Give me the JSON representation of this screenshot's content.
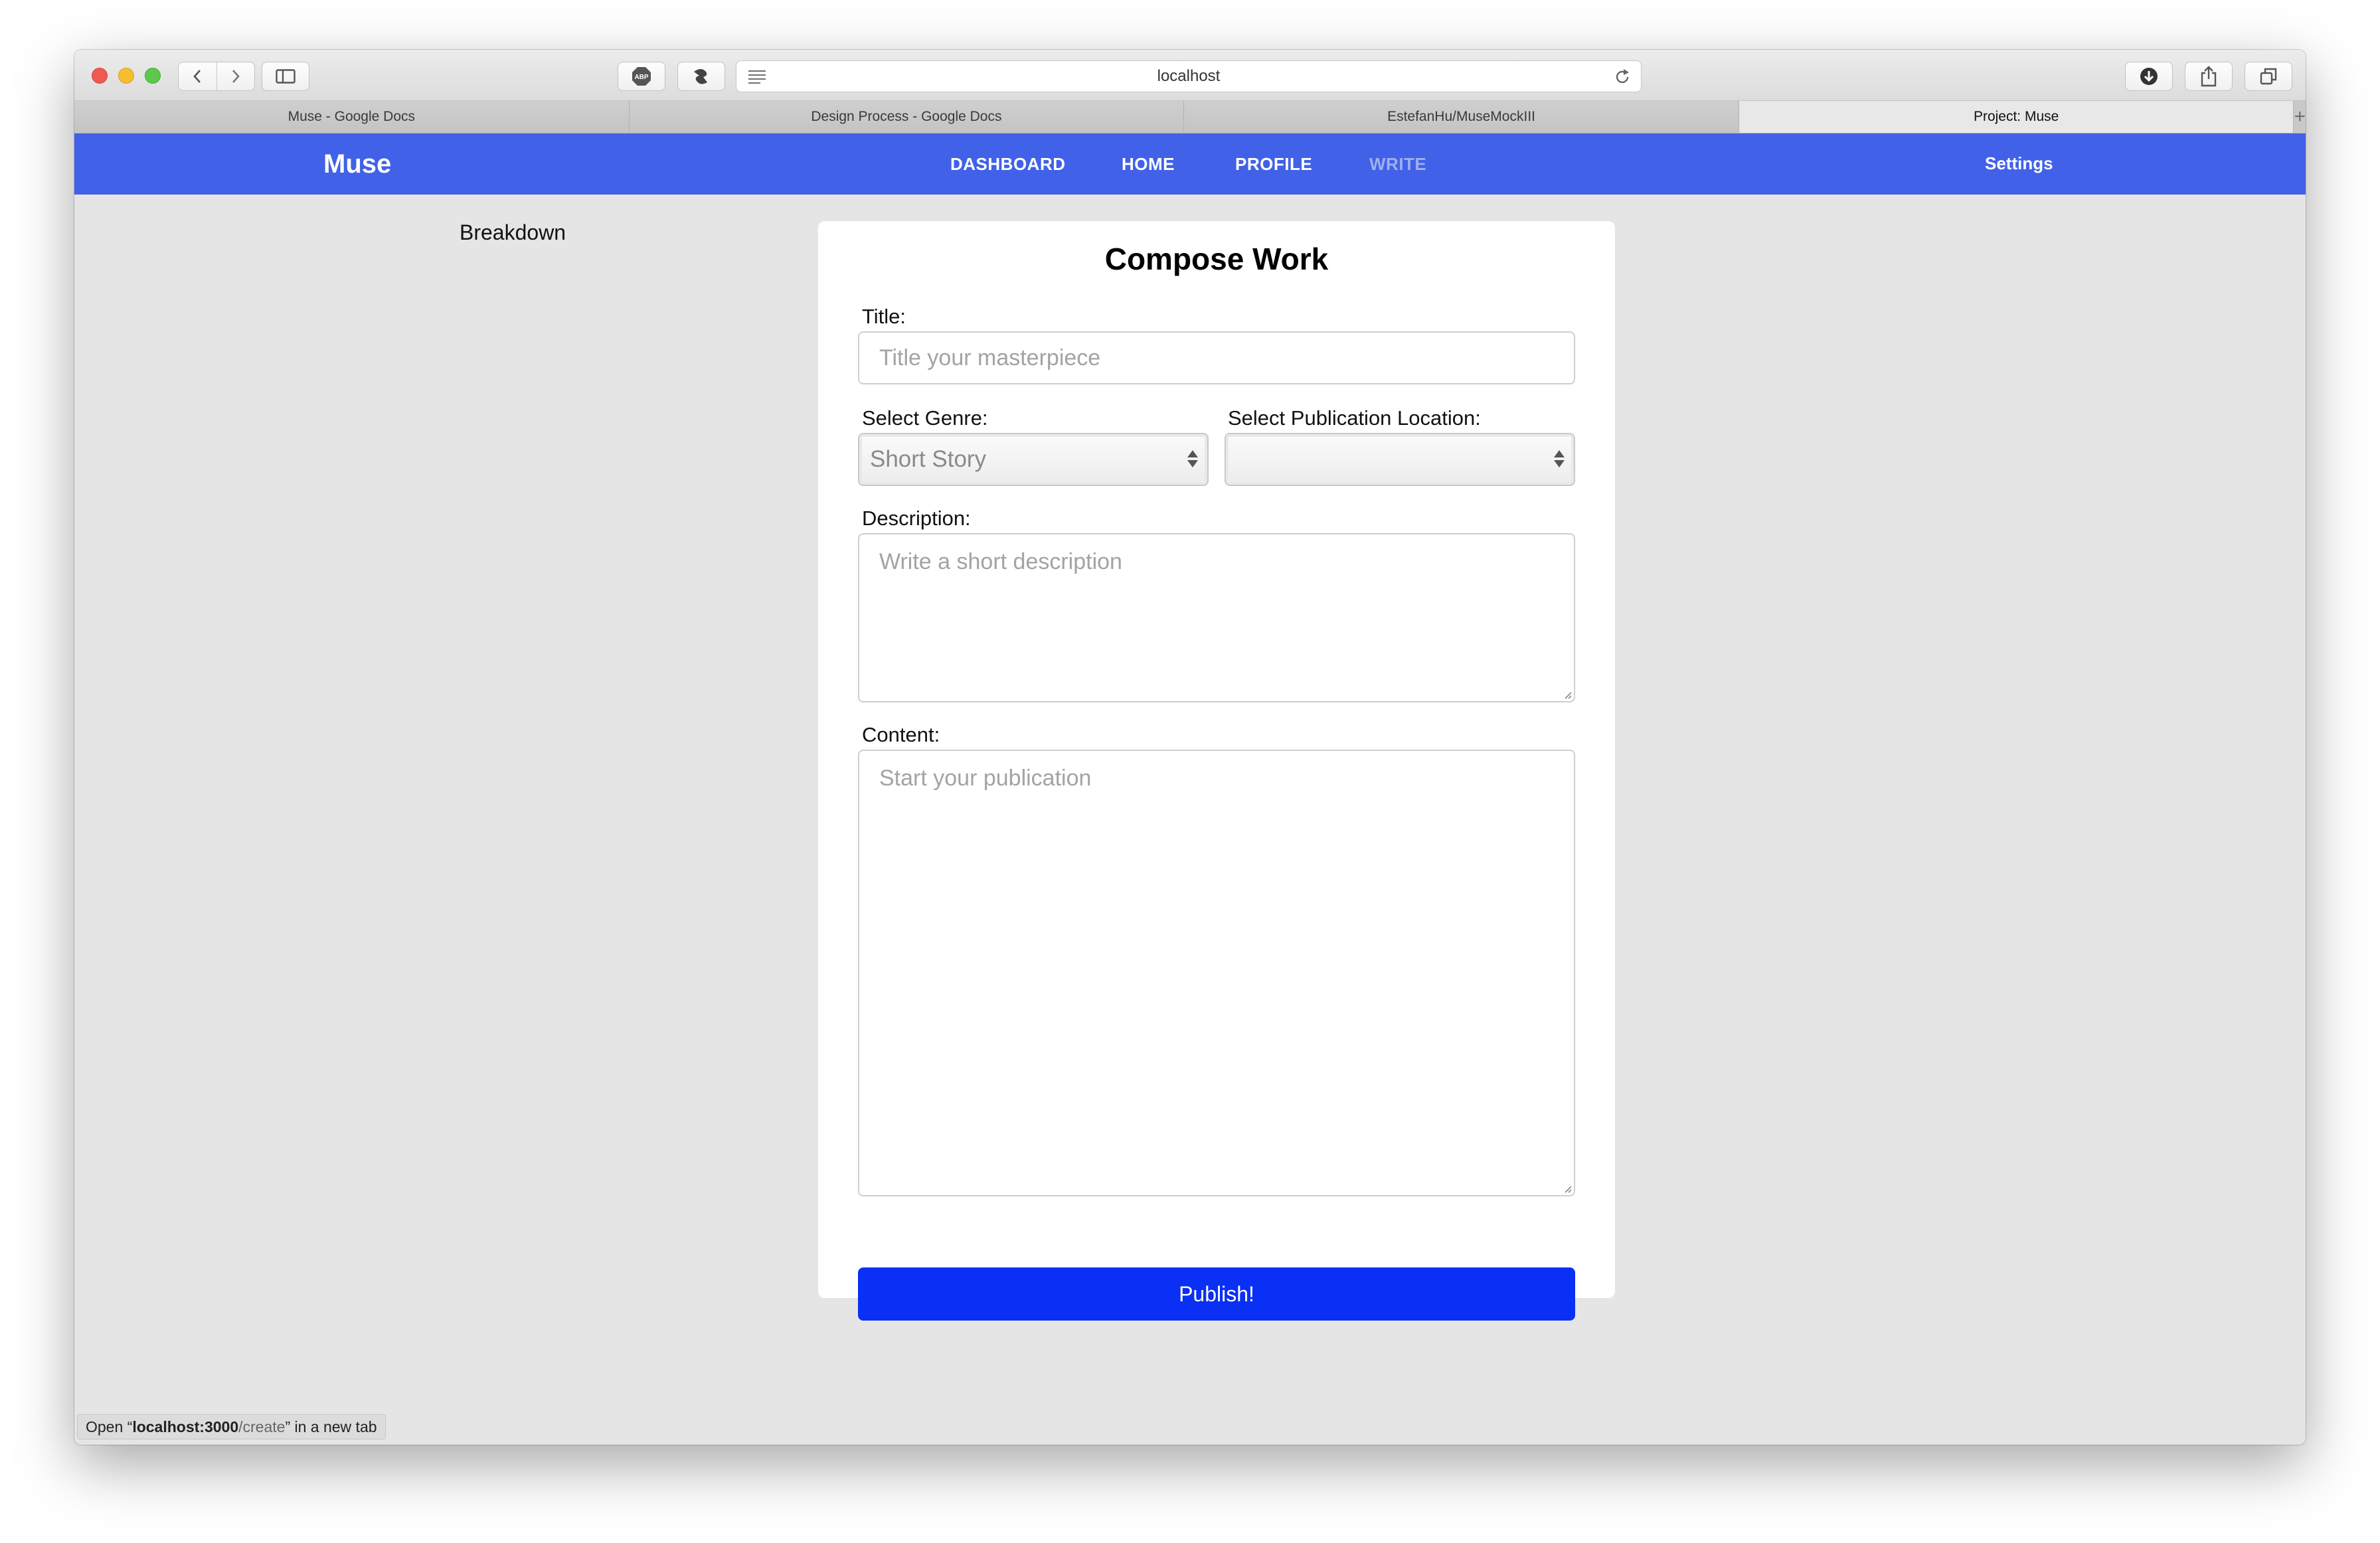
{
  "browser": {
    "url": "localhost",
    "tabs": [
      {
        "label": "Muse - Google Docs",
        "active": false
      },
      {
        "label": "Design Process - Google Docs",
        "active": false
      },
      {
        "label": "EstefanHu/MuseMockIII",
        "active": false
      },
      {
        "label": "Project: Muse",
        "active": true
      }
    ],
    "new_tab_symbol": "+",
    "status": {
      "prefix": "Open “",
      "host": "localhost:3000",
      "path": "/create",
      "suffix": "” in a new tab"
    }
  },
  "navbar": {
    "brand": "Muse",
    "links": [
      "DASHBOARD",
      "HOME",
      "PROFILE",
      "WRITE"
    ],
    "active_link": "WRITE",
    "settings": "Settings",
    "color": "#4161e8"
  },
  "sidebar": {
    "breakdown_label": "Breakdown"
  },
  "form": {
    "heading": "Compose Work",
    "title_label": "Title:",
    "title_placeholder": "Title your masterpiece",
    "genre_label": "Select Genre:",
    "genre_value": "Short Story",
    "location_label": "Select Publication Location:",
    "location_value": "",
    "description_label": "Description:",
    "description_placeholder": "Write a short description",
    "content_label": "Content:",
    "content_placeholder": "Start your publication",
    "publish_label": "Publish!",
    "publish_color": "#0a2ff5"
  },
  "icons": {
    "back": "chevron-left-icon",
    "forward": "chevron-right-icon",
    "sidebar": "sidebar-icon",
    "adblock": "abp-icon",
    "extension": "extension-icon",
    "reader": "reader-icon",
    "reload": "reload-icon",
    "downloads": "download-icon",
    "share": "share-icon",
    "tabs": "tabs-overview-icon"
  }
}
